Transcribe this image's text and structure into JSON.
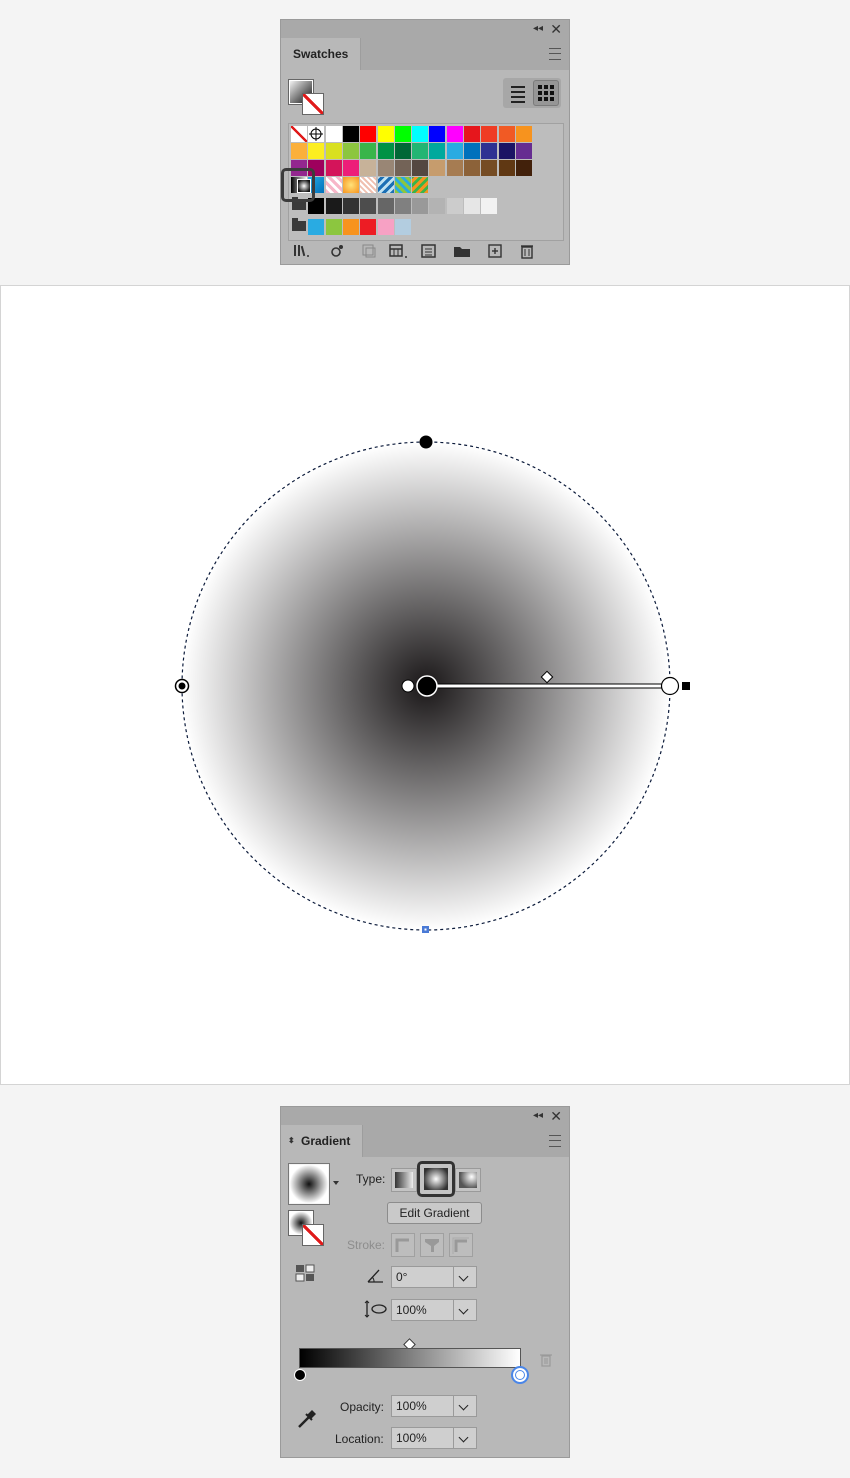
{
  "swatches_panel": {
    "title": "Swatches",
    "colors": {
      "row1": [
        "none",
        "registration",
        "#ffffff",
        "#000000",
        "#ff0000",
        "#ffff00",
        "#00ff00",
        "#00ffff",
        "#0000ff",
        "#ff00ff",
        "#e6161c",
        "#ef3c24",
        "#f15a24",
        "#f7931e"
      ],
      "row2": [
        "#fbb03b",
        "#fcee21",
        "#d9e021",
        "#8cc63f",
        "#39b54a",
        "#009245",
        "#006837",
        "#22b573",
        "#00a99d",
        "#29abe2",
        "#0071bc",
        "#2e3192",
        "#1b1464",
        "#662d91"
      ],
      "row3": [
        "#93278f",
        "#9e005d",
        "#d4145a",
        "#ed1e79",
        "#c7b299",
        "#998675",
        "#736357",
        "#534741",
        "#c69c6d",
        "#a67c52",
        "#8c6239",
        "#754c24",
        "#603813",
        "#42210b"
      ],
      "row4_extras": [
        "#29abe2",
        "#f7b6c8",
        "#f7931e"
      ],
      "grays": [
        "#000000",
        "#1a1a1a",
        "#333333",
        "#4d4d4d",
        "#666666",
        "#808080",
        "#999999",
        "#b3b3b3",
        "#cccccc",
        "#e6e6e6",
        "#f2f2f2"
      ],
      "group": [
        "#29abe2",
        "#8cc63f",
        "#f7931e",
        "#ed1c24",
        "#f7a1c4",
        "#b3cde0"
      ]
    },
    "selected_swatch": "radial-gradient",
    "view": "grid"
  },
  "gradient_panel": {
    "title": "Gradient",
    "type_label": "Type:",
    "edit_button": "Edit Gradient",
    "stroke_label": "Stroke:",
    "angle_value": "0°",
    "aspect_value": "100%",
    "opacity_label": "Opacity:",
    "opacity_value": "100%",
    "location_label": "Location:",
    "location_value": "100%",
    "selected_type": "radial",
    "stops": [
      {
        "color": "#000000",
        "location": 0
      },
      {
        "color": "#ffffff",
        "location": 100
      }
    ],
    "midpoint": 50
  },
  "canvas": {
    "shape": "circle",
    "fill": "radial-gradient",
    "gradient_colors": [
      "#1a1718",
      "#ffffff"
    ]
  }
}
